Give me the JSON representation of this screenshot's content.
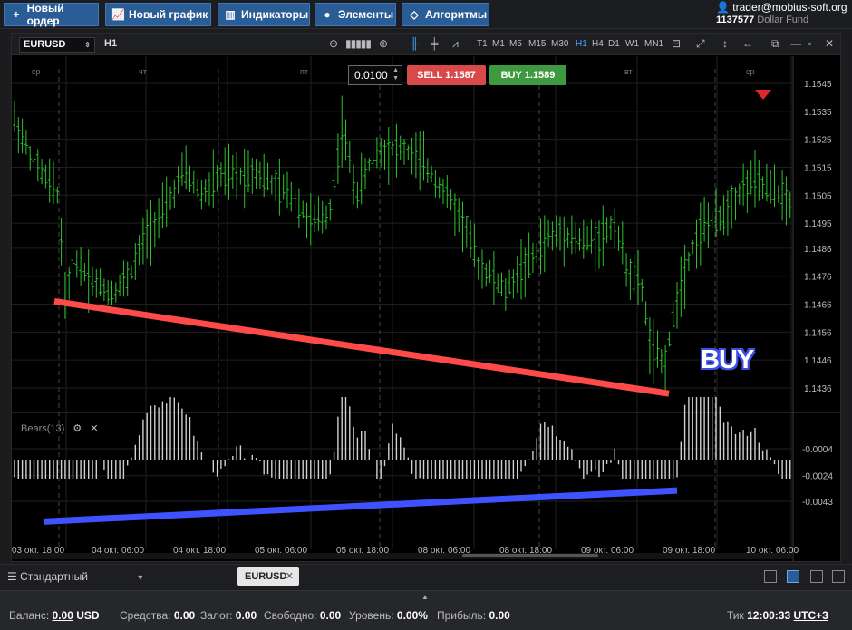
{
  "toolbar": {
    "new_order": "Новый ордер",
    "new_chart": "Новый график",
    "indicators": "Индикаторы",
    "elements": "Элементы",
    "algorithms": "Алгоритмы"
  },
  "account": {
    "user": "trader@mobius-soft.org",
    "id": "1137577",
    "fund": "Dollar Fund"
  },
  "chart_window": {
    "symbol": "EURUSD",
    "timeframe": "H1",
    "timeframes": [
      "T1",
      "M1",
      "M5",
      "M15",
      "M30",
      "H1",
      "H4",
      "D1",
      "W1",
      "MN1"
    ],
    "active_timeframe": "H1"
  },
  "order_panel": {
    "lot": "0.0100",
    "sell_label": "SELL",
    "sell_price": "1.1587",
    "buy_label": "BUY",
    "buy_price": "1.1589"
  },
  "annotation": {
    "buy_text": "BUY"
  },
  "indicator": {
    "name": "Bears(13)"
  },
  "chart_data": {
    "type": "candlestick",
    "symbol": "EURUSD",
    "timeframe": "H1",
    "price_axis": [
      "1.1545",
      "1.1535",
      "1.1525",
      "1.1515",
      "1.1505",
      "1.1495",
      "1.1486",
      "1.1476",
      "1.1466",
      "1.1456",
      "1.1446",
      "1.1436"
    ],
    "day_labels": [
      "ср",
      "чт",
      "пт",
      "вт",
      "ср"
    ],
    "time_axis": [
      "03 окт. 18:00",
      "04 окт. 06:00",
      "04 окт. 18:00",
      "05 окт. 06:00",
      "05 окт. 18:00",
      "08 окт. 06:00",
      "08 окт. 18:00",
      "09 окт. 06:00",
      "09 окт. 18:00",
      "10 окт. 06:00"
    ],
    "price_range": [
      1.143,
      1.155
    ],
    "indicator_axis": [
      "-0.0004",
      "-0.0024",
      "-0.0043"
    ],
    "indicator_range": [
      -0.0056,
      0.0012
    ],
    "colors": {
      "candles": "#2fc22f",
      "price_trendline": "#ff4a4a",
      "indicator_trendline": "#3f52ff",
      "indicator_bars": "#d0d0d0"
    }
  },
  "bottom_tabs": {
    "layout": "Стандартный",
    "tab": "EURUSD"
  },
  "status": {
    "balance_label": "Баланс:",
    "balance_value": "0.00",
    "balance_currency": "USD",
    "funds_label": "Средства:",
    "funds_value": "0.00",
    "margin_label": "Залог:",
    "margin_value": "0.00",
    "free_label": "Свободно:",
    "free_value": "0.00",
    "level_label": "Уровень:",
    "level_value": "0.00%",
    "profit_label": "Прибыль:",
    "profit_value": "0.00",
    "tick_label": "Тик",
    "tick_time": "12:00:33",
    "tz": "UTC+3"
  }
}
